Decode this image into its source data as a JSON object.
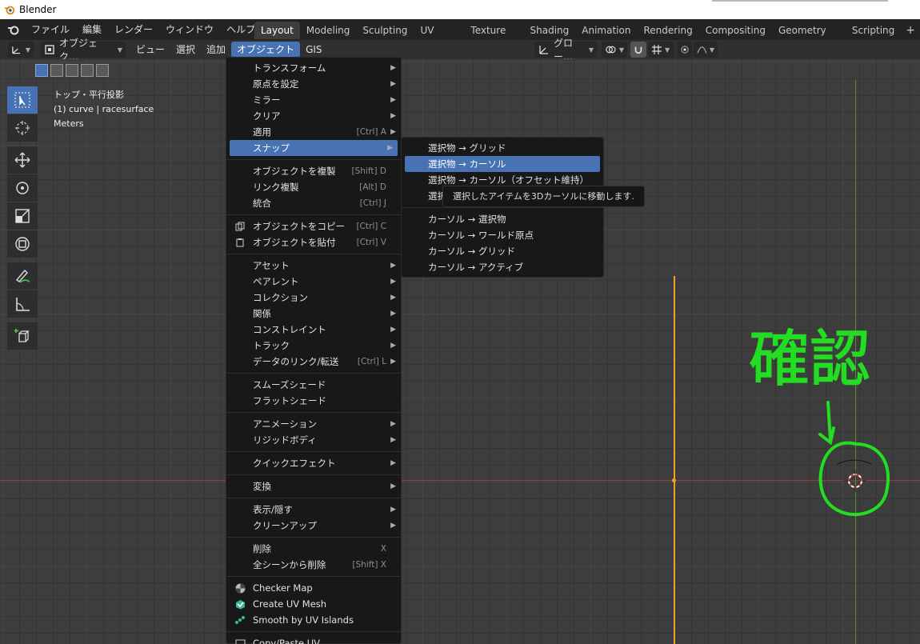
{
  "window": {
    "title": "Blender"
  },
  "menubar": {
    "items": [
      "ファイル",
      "編集",
      "レンダー",
      "ウィンドウ",
      "ヘルプ"
    ]
  },
  "workspaces": {
    "tabs": [
      "Layout",
      "Modeling",
      "Sculpting",
      "UV Editing",
      "Texture Paint",
      "Shading",
      "Animation",
      "Rendering",
      "Compositing",
      "Geometry Nodes",
      "Scripting"
    ],
    "active": "Layout",
    "add_label": "+"
  },
  "header": {
    "mode": "オブジェク…",
    "view": "ビュー",
    "select": "選択",
    "add": "追加",
    "object": "オブジェクト",
    "gis": "GIS",
    "transform_orientation": "グロー…"
  },
  "viewport_overlay": {
    "view_name": "トップ・平行投影",
    "object_info": "(1) curve | racesurface",
    "units": "Meters"
  },
  "object_menu": {
    "items": [
      {
        "label": "トランスフォーム",
        "shortcut": "",
        "submenu": true
      },
      {
        "label": "原点を設定",
        "shortcut": "",
        "submenu": true
      },
      {
        "label": "ミラー",
        "shortcut": "",
        "submenu": true
      },
      {
        "label": "クリア",
        "shortcut": "",
        "submenu": true
      },
      {
        "label": "適用",
        "shortcut": "[Ctrl] A",
        "submenu": true
      },
      {
        "label": "スナップ",
        "shortcut": "",
        "submenu": true,
        "highlighted": true
      },
      {
        "separator": true
      },
      {
        "label": "オブジェクトを複製",
        "shortcut": "[Shift] D"
      },
      {
        "label": "リンク複製",
        "shortcut": "[Alt] D"
      },
      {
        "label": "統合",
        "shortcut": "[Ctrl] J"
      },
      {
        "separator": true
      },
      {
        "label": "オブジェクトをコピー",
        "shortcut": "[Ctrl] C",
        "icon": "copy"
      },
      {
        "label": "オブジェクトを貼付",
        "shortcut": "[Ctrl] V",
        "icon": "paste"
      },
      {
        "separator": true
      },
      {
        "label": "アセット",
        "shortcut": "",
        "submenu": true
      },
      {
        "label": "ペアレント",
        "shortcut": "",
        "submenu": true
      },
      {
        "label": "コレクション",
        "shortcut": "",
        "submenu": true
      },
      {
        "label": "関係",
        "shortcut": "",
        "submenu": true
      },
      {
        "label": "コンストレイント",
        "shortcut": "",
        "submenu": true
      },
      {
        "label": "トラック",
        "shortcut": "",
        "submenu": true
      },
      {
        "label": "データのリンク/転送",
        "shortcut": "[Ctrl] L",
        "submenu": true
      },
      {
        "separator": true
      },
      {
        "label": "スムーズシェード",
        "shortcut": ""
      },
      {
        "label": "フラットシェード",
        "shortcut": ""
      },
      {
        "separator": true
      },
      {
        "label": "アニメーション",
        "shortcut": "",
        "submenu": true
      },
      {
        "label": "リジッドボディ",
        "shortcut": "",
        "submenu": true
      },
      {
        "separator": true
      },
      {
        "label": "クイックエフェクト",
        "shortcut": "",
        "submenu": true
      },
      {
        "separator": true
      },
      {
        "label": "変換",
        "shortcut": "",
        "submenu": true
      },
      {
        "separator": true
      },
      {
        "label": "表示/隠す",
        "shortcut": "",
        "submenu": true
      },
      {
        "label": "クリーンアップ",
        "shortcut": "",
        "submenu": true
      },
      {
        "separator": true
      },
      {
        "label": "削除",
        "shortcut": "X"
      },
      {
        "label": "全シーンから削除",
        "shortcut": "[Shift] X"
      },
      {
        "separator": true
      },
      {
        "label": "Checker Map",
        "shortcut": "",
        "icon": "checker"
      },
      {
        "label": "Create UV Mesh",
        "shortcut": "",
        "icon": "uvmesh"
      },
      {
        "label": "Smooth by UV Islands",
        "shortcut": "",
        "icon": "smooth"
      },
      {
        "separator": true
      },
      {
        "label": "Copy/Paste UV",
        "shortcut": "",
        "icon": "copyuv"
      }
    ]
  },
  "snap_submenu": {
    "items": [
      {
        "label": "選択物 → グリッド"
      },
      {
        "label": "選択物 → カーソル",
        "highlighted": true
      },
      {
        "label": "選択物 → カーソル（オフセット維持）"
      },
      {
        "label": "選択"
      },
      {
        "separator": true
      },
      {
        "label": "カーソル → 選択物"
      },
      {
        "label": "カーソル → ワールド原点"
      },
      {
        "label": "カーソル → グリッド"
      },
      {
        "label": "カーソル → アクティブ"
      }
    ]
  },
  "tooltip": {
    "text": "選択したアイテムを3Dカーソルに移動します."
  },
  "annotation": {
    "text": "確認",
    "color": "#22dd22"
  },
  "colors": {
    "accent": "#4772b3",
    "x_axis": "#9b3b3b",
    "y_axis": "#5a8a3a",
    "curve": "#f0a02c"
  }
}
